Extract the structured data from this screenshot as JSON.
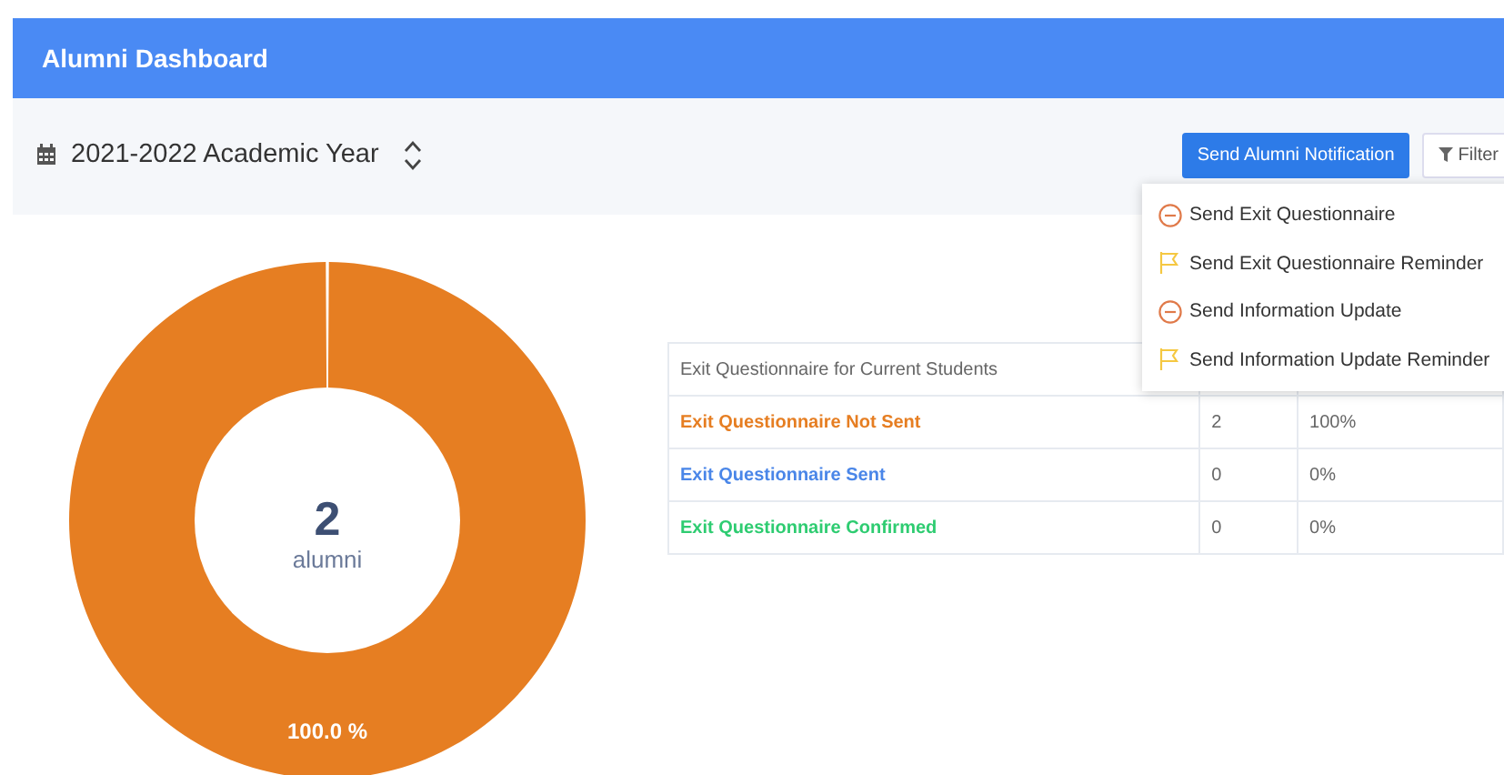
{
  "header": {
    "title": "Alumni Dashboard"
  },
  "year_selector": {
    "label": "2021-2022 Academic Year"
  },
  "actions": {
    "notify_button": "Send Alumni Notification",
    "filter_button": "Filter"
  },
  "notification_menu": {
    "items": [
      {
        "kind": "send",
        "label": "Send Exit Questionnaire"
      },
      {
        "kind": "reminder",
        "label": "Send Exit Questionnaire Reminder"
      },
      {
        "kind": "send",
        "label": "Send Information Update"
      },
      {
        "kind": "reminder",
        "label": "Send Information Update Reminder"
      }
    ]
  },
  "donut": {
    "count": "2",
    "unit": "alumni",
    "chart_data": {
      "type": "donut",
      "values": [
        100
      ],
      "colors": [
        "#e67e22"
      ],
      "value_labels": [
        "100.0 %"
      ]
    }
  },
  "table": {
    "title": "Exit Questionnaire for Current Students",
    "rows": [
      {
        "label": "Exit Questionnaire Not Sent",
        "count": "2",
        "percent": "100%",
        "color": "#e67e22"
      },
      {
        "label": "Exit Questionnaire Sent",
        "count": "0",
        "percent": "0%",
        "color": "#4a86e8"
      },
      {
        "label": "Exit Questionnaire Confirmed",
        "count": "0",
        "percent": "0%",
        "color": "#2ecc71"
      }
    ]
  }
}
